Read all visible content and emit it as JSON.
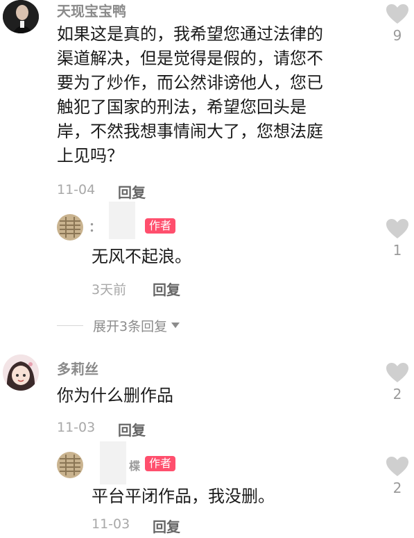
{
  "comments": [
    {
      "username": "天现宝宝鸭",
      "text_lines": [
        "如果这是真的，我希望您通过法律的",
        "渠道解决，但是觉得是假的，请您不",
        "要为了炒作，而公然诽谤他人，您已",
        "触犯了国家的刑法，希望您回头是",
        "岸，不然我想事情闹大了，您想法庭",
        "上见吗？"
      ],
      "date": "11-04",
      "reply_label": "回复",
      "likes": "9",
      "reply": {
        "username_partial": "：",
        "badge": "作者",
        "text": "无风不起浪。",
        "date": "3天前",
        "reply_label": "回复",
        "likes": "1"
      },
      "expand_label": "展开3条回复"
    },
    {
      "username": "多莉丝",
      "text_lines": [
        "你为什么删作品"
      ],
      "date": "11-03",
      "reply_label": "回复",
      "likes": "2",
      "reply": {
        "username_partial": "楪",
        "badge": "作者",
        "text": "平台平闭作品，我没删。",
        "date": "11-03",
        "reply_label": "回复",
        "likes": "2"
      }
    }
  ],
  "colors": {
    "badge": "#ff4f6d",
    "heart": "#cfcfcf"
  },
  "icons": {
    "like": "heart-icon",
    "expand": "triangle-down-icon"
  }
}
